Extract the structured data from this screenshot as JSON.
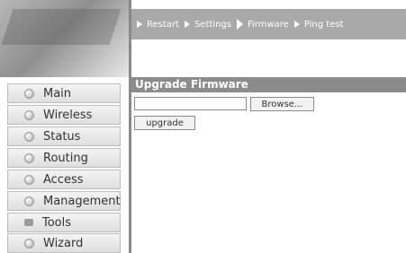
{
  "topnav": {
    "items": [
      {
        "label": "Restart"
      },
      {
        "label": "Settings"
      },
      {
        "label": "Firmware"
      },
      {
        "label": "Ping test"
      }
    ]
  },
  "sidebar": {
    "items": [
      {
        "label": "Main"
      },
      {
        "label": "Wireless"
      },
      {
        "label": "Status"
      },
      {
        "label": "Routing"
      },
      {
        "label": "Access"
      },
      {
        "label": "Management"
      },
      {
        "label": "Tools"
      },
      {
        "label": "Wizard"
      }
    ]
  },
  "main": {
    "section_title": "Upgrade Firmware",
    "file_input_value": "",
    "browse_label": "Browse...",
    "upgrade_label": "upgrade"
  }
}
